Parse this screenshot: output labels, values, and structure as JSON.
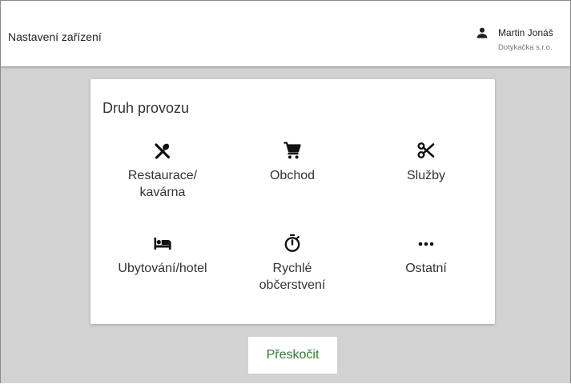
{
  "header": {
    "title": "Nastavení zařízení",
    "user_icon": "person-icon",
    "user_name": "Martin Jonáš",
    "user_company": "Dotykačka s.r.o."
  },
  "card": {
    "title": "Druh provozu",
    "options": [
      {
        "label": "Restaurace/\nkavárna",
        "icon": "restaurant-icon"
      },
      {
        "label": "Obchod",
        "icon": "shopping-cart-icon"
      },
      {
        "label": "Služby",
        "icon": "scissors-icon"
      },
      {
        "label": "Ubytování/hotel",
        "icon": "hotel-bed-icon"
      },
      {
        "label": "Rychlé\nobčerstvení",
        "icon": "timer-icon"
      },
      {
        "label": "Ostatní",
        "icon": "more-horizontal-icon"
      }
    ]
  },
  "skip_button": {
    "label": "Přeskočit"
  },
  "colors": {
    "background": "#d2d2d2",
    "card": "#ffffff",
    "accent_green": "#2e7d32",
    "text": "#333333"
  }
}
